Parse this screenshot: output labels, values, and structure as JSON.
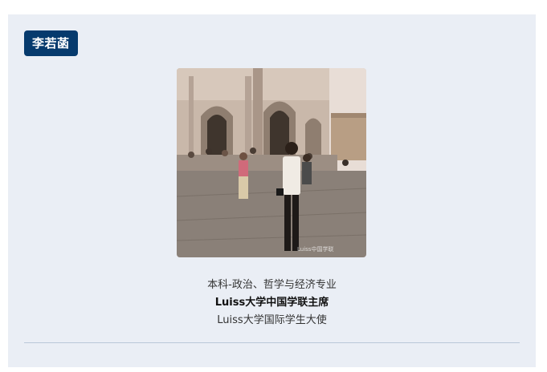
{
  "profile": {
    "name": "李若菡",
    "photo_watermark": "Luiss中国学联",
    "line1": "本科-政治、哲学与经济专业",
    "line2": "Luiss大学中国学联主席",
    "line3": "Luiss大学国际学生大使"
  },
  "colors": {
    "badge_bg": "#063a6d",
    "card_bg": "#eaeef5",
    "divider": "#b9c7d8"
  }
}
